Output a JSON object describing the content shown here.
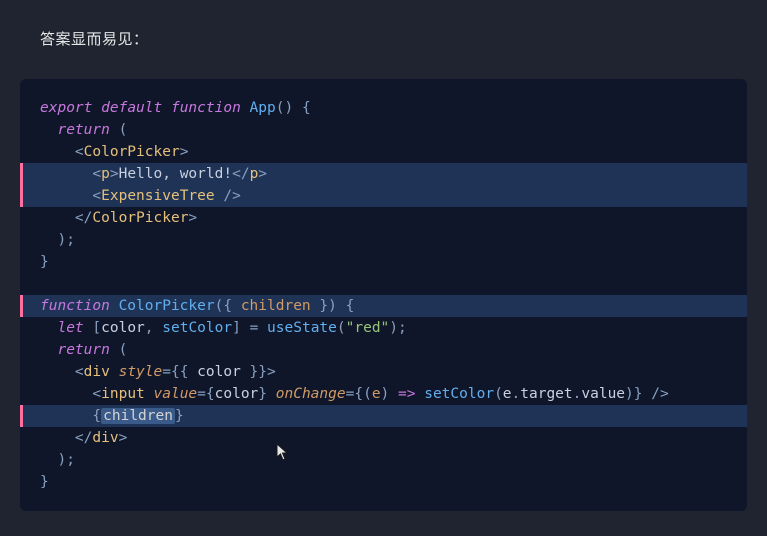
{
  "caption": "答案显而易见：",
  "code": {
    "lines": [
      {
        "hl": false,
        "tokens": [
          {
            "c": "kw",
            "t": "export"
          },
          {
            "c": "txt",
            "t": " "
          },
          {
            "c": "kw",
            "t": "default"
          },
          {
            "c": "txt",
            "t": " "
          },
          {
            "c": "kw",
            "t": "function"
          },
          {
            "c": "txt",
            "t": " "
          },
          {
            "c": "fn",
            "t": "App"
          },
          {
            "c": "punct",
            "t": "()"
          },
          {
            "c": "txt",
            "t": " "
          },
          {
            "c": "punct",
            "t": "{"
          }
        ]
      },
      {
        "hl": false,
        "tokens": [
          {
            "c": "txt",
            "t": "  "
          },
          {
            "c": "kw",
            "t": "return"
          },
          {
            "c": "txt",
            "t": " "
          },
          {
            "c": "punct",
            "t": "("
          }
        ]
      },
      {
        "hl": false,
        "tokens": [
          {
            "c": "txt",
            "t": "    "
          },
          {
            "c": "punct",
            "t": "<"
          },
          {
            "c": "tag",
            "t": "ColorPicker"
          },
          {
            "c": "punct",
            "t": ">"
          }
        ]
      },
      {
        "hl": true,
        "tokens": [
          {
            "c": "txt",
            "t": "      "
          },
          {
            "c": "punct",
            "t": "<"
          },
          {
            "c": "tag",
            "t": "p"
          },
          {
            "c": "punct",
            "t": ">"
          },
          {
            "c": "txt",
            "t": "Hello, world!"
          },
          {
            "c": "punct",
            "t": "</"
          },
          {
            "c": "tag",
            "t": "p"
          },
          {
            "c": "punct",
            "t": ">"
          }
        ]
      },
      {
        "hl": true,
        "tokens": [
          {
            "c": "txt",
            "t": "      "
          },
          {
            "c": "punct",
            "t": "<"
          },
          {
            "c": "tag",
            "t": "ExpensiveTree"
          },
          {
            "c": "txt",
            "t": " "
          },
          {
            "c": "punct",
            "t": "/>"
          }
        ]
      },
      {
        "hl": false,
        "tokens": [
          {
            "c": "txt",
            "t": "    "
          },
          {
            "c": "punct",
            "t": "</"
          },
          {
            "c": "tag",
            "t": "ColorPicker"
          },
          {
            "c": "punct",
            "t": ">"
          }
        ]
      },
      {
        "hl": false,
        "tokens": [
          {
            "c": "txt",
            "t": "  "
          },
          {
            "c": "punct",
            "t": ");"
          }
        ]
      },
      {
        "hl": false,
        "tokens": [
          {
            "c": "punct",
            "t": "}"
          }
        ]
      },
      {
        "hl": false,
        "tokens": [
          {
            "c": "txt",
            "t": " "
          }
        ]
      },
      {
        "hl": true,
        "tokens": [
          {
            "c": "kw",
            "t": "function"
          },
          {
            "c": "txt",
            "t": " "
          },
          {
            "c": "fn",
            "t": "ColorPicker"
          },
          {
            "c": "punct",
            "t": "({ "
          },
          {
            "c": "param",
            "t": "children"
          },
          {
            "c": "punct",
            "t": " })"
          },
          {
            "c": "txt",
            "t": " "
          },
          {
            "c": "punct",
            "t": "{"
          }
        ]
      },
      {
        "hl": false,
        "tokens": [
          {
            "c": "txt",
            "t": "  "
          },
          {
            "c": "kw",
            "t": "let"
          },
          {
            "c": "txt",
            "t": " "
          },
          {
            "c": "punct",
            "t": "["
          },
          {
            "c": "txt",
            "t": "color"
          },
          {
            "c": "punct",
            "t": ", "
          },
          {
            "c": "fn",
            "t": "setColor"
          },
          {
            "c": "punct",
            "t": "]"
          },
          {
            "c": "txt",
            "t": " "
          },
          {
            "c": "punct",
            "t": "= "
          },
          {
            "c": "fn",
            "t": "useState"
          },
          {
            "c": "punct",
            "t": "("
          },
          {
            "c": "str",
            "t": "\"red\""
          },
          {
            "c": "punct",
            "t": ");"
          }
        ]
      },
      {
        "hl": false,
        "tokens": [
          {
            "c": "txt",
            "t": "  "
          },
          {
            "c": "kw",
            "t": "return"
          },
          {
            "c": "txt",
            "t": " "
          },
          {
            "c": "punct",
            "t": "("
          }
        ]
      },
      {
        "hl": false,
        "tokens": [
          {
            "c": "txt",
            "t": "    "
          },
          {
            "c": "punct",
            "t": "<"
          },
          {
            "c": "tag",
            "t": "div"
          },
          {
            "c": "txt",
            "t": " "
          },
          {
            "c": "attr",
            "t": "style"
          },
          {
            "c": "punct",
            "t": "={{ "
          },
          {
            "c": "txt",
            "t": "color"
          },
          {
            "c": "punct",
            "t": " }}>"
          }
        ]
      },
      {
        "hl": false,
        "tokens": [
          {
            "c": "txt",
            "t": "      "
          },
          {
            "c": "punct",
            "t": "<"
          },
          {
            "c": "tag",
            "t": "input"
          },
          {
            "c": "txt",
            "t": " "
          },
          {
            "c": "attr",
            "t": "value"
          },
          {
            "c": "punct",
            "t": "={"
          },
          {
            "c": "txt",
            "t": "color"
          },
          {
            "c": "punct",
            "t": "} "
          },
          {
            "c": "attr",
            "t": "onChange"
          },
          {
            "c": "punct",
            "t": "={("
          },
          {
            "c": "param",
            "t": "e"
          },
          {
            "c": "punct",
            "t": ") "
          },
          {
            "c": "arrow",
            "t": "=>"
          },
          {
            "c": "txt",
            "t": " "
          },
          {
            "c": "fn",
            "t": "setColor"
          },
          {
            "c": "punct",
            "t": "("
          },
          {
            "c": "txt",
            "t": "e"
          },
          {
            "c": "punct",
            "t": "."
          },
          {
            "c": "txt",
            "t": "target"
          },
          {
            "c": "punct",
            "t": "."
          },
          {
            "c": "txt",
            "t": "value"
          },
          {
            "c": "punct",
            "t": ")} />"
          }
        ]
      },
      {
        "hl": true,
        "tokens": [
          {
            "c": "txt",
            "t": "      "
          },
          {
            "c": "punct",
            "t": "{"
          },
          {
            "c": "hlchild",
            "t": "children"
          },
          {
            "c": "punct",
            "t": "}"
          }
        ]
      },
      {
        "hl": false,
        "tokens": [
          {
            "c": "txt",
            "t": "    "
          },
          {
            "c": "punct",
            "t": "</"
          },
          {
            "c": "tag",
            "t": "div"
          },
          {
            "c": "punct",
            "t": ">"
          }
        ]
      },
      {
        "hl": false,
        "tokens": [
          {
            "c": "txt",
            "t": "  "
          },
          {
            "c": "punct",
            "t": ");"
          }
        ]
      },
      {
        "hl": false,
        "tokens": [
          {
            "c": "punct",
            "t": "}"
          }
        ]
      }
    ]
  }
}
